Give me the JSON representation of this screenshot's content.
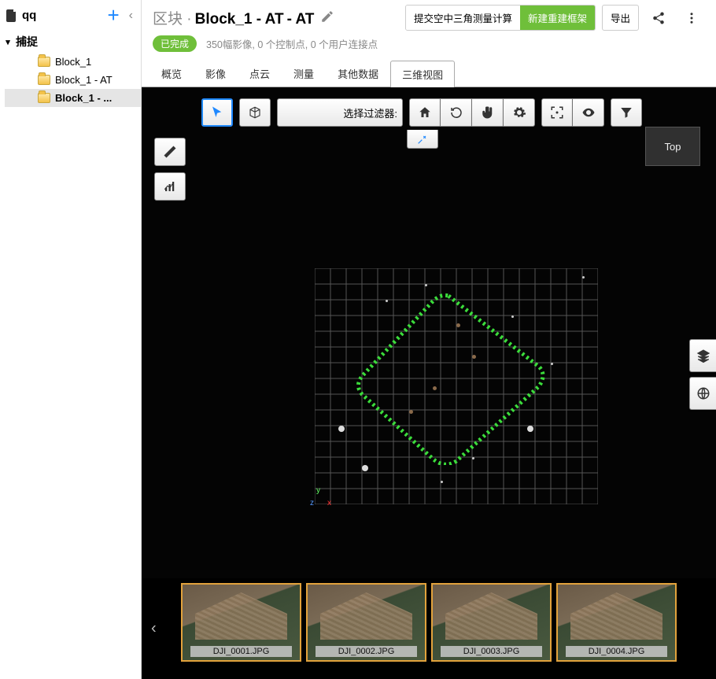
{
  "sidebar": {
    "project_name": "qq",
    "section_label": "捕捉",
    "items": [
      {
        "label": "Block_1"
      },
      {
        "label": "Block_1 - AT"
      },
      {
        "label": "Block_1 - ..."
      }
    ],
    "selected_index": 2
  },
  "header": {
    "crumb_prefix": "区块 ·",
    "crumb_bold": "Block_1 - AT",
    "crumb_suffix": "- AT",
    "btn_submit_at": "提交空中三角测量计算",
    "btn_new_recon": "新建重建框架",
    "btn_export": "导出"
  },
  "status": {
    "badge": "已完成",
    "text": "350幅影像, 0 个控制点, 0 个用户连接点"
  },
  "tabs": {
    "items": [
      "概览",
      "影像",
      "点云",
      "测量",
      "其他数据",
      "三维视图"
    ],
    "active_index": 5
  },
  "viewport": {
    "filter_label": "选择过滤器:",
    "view_label": "Top",
    "axes": {
      "x": "x",
      "y": "y",
      "z": "z"
    }
  },
  "thumbnails": [
    {
      "name": "DJI_0001.JPG"
    },
    {
      "name": "DJI_0002.JPG"
    },
    {
      "name": "DJI_0003.JPG"
    },
    {
      "name": "DJI_0004.JPG"
    }
  ]
}
